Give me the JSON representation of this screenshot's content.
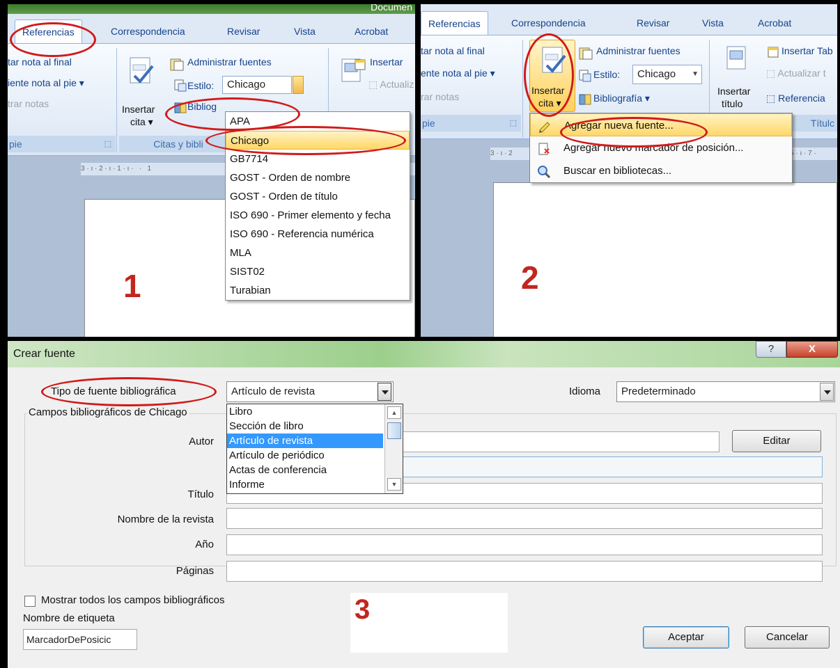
{
  "panel1": {
    "title_fragment": "Documen",
    "tabs": [
      "Referencias",
      "Correspondencia",
      "Revisar",
      "Vista",
      "Acrobat"
    ],
    "ribbon": {
      "footnote_cmds": [
        "tar nota al final",
        "iente nota al pie",
        "trar notas"
      ],
      "footnote_group": "pie",
      "insert_citation": [
        "Insertar",
        "cita"
      ],
      "manage_sources": "Administrar fuentes",
      "style_label": "Estilo:",
      "style_value": "Chicago",
      "bibliography_partial": "Bibliog",
      "citations_group": "Citas y bibli",
      "caption_partial": "Insertar",
      "update_partial": "Actualiz"
    },
    "ruler": "3 · ı · 2 · ı · 1 · ı ·   ·   1",
    "style_options": [
      "APA",
      "Chicago",
      "GB7714",
      "GOST - Orden de nombre",
      "GOST - Orden de título",
      "ISO 690 - Primer elemento y fecha",
      "ISO 690 - Referencia numérica",
      "MLA",
      "SIST02",
      "Turabian"
    ],
    "selected_style": "Chicago",
    "step": "1"
  },
  "panel2": {
    "tabs": [
      "Referencias",
      "Correspondencia",
      "Revisar",
      "Vista",
      "Acrobat"
    ],
    "ribbon": {
      "footnote_cmds": [
        "tar nota al final",
        "ente nota al pie",
        "rar notas"
      ],
      "footnote_group": "pie",
      "insert_citation": [
        "Insertar",
        "cita"
      ],
      "manage_sources": "Administrar fuentes",
      "style_label": "Estilo:",
      "style_value": "Chicago",
      "bibliography": "Bibliografía",
      "insert_caption": [
        "Insertar",
        "título"
      ],
      "insert_table_partial": "Insertar Tab",
      "update_partial": "Actualizar t",
      "cross_ref_partial": "Referencia",
      "caption_group_partial": "Títulc"
    },
    "ruler_left": "3 · ı · 2",
    "ruler_right": "5 · ı · 7 ·",
    "menu": [
      {
        "label": "Agregar nueva fuente...",
        "icon": "add-source-icon"
      },
      {
        "label": "Agregar nuevo marcador de posición...",
        "icon": "add-placeholder-icon"
      },
      {
        "label": "Buscar en bibliotecas...",
        "icon": "search-libraries-icon"
      }
    ],
    "step": "2"
  },
  "dialog": {
    "title": "Crear fuente",
    "help_button": "?",
    "close_button": "X",
    "source_type_label": "Tipo de fuente bibliográfica",
    "source_type_value": "Artículo de revista",
    "source_type_options": [
      "Libro",
      "Sección de libro",
      "Artículo de revista",
      "Artículo de periódico",
      "Actas de conferencia",
      "Informe"
    ],
    "language_label": "Idioma",
    "language_value": "Predeterminado",
    "fields_group_label": "Campos bibliográficos de Chicago",
    "fields": {
      "author_label": "Autor",
      "author_value": "",
      "title_label": "Título",
      "journal_label": "Nombre de la revista",
      "year_label": "Año",
      "pages_label": "Páginas"
    },
    "edit_button": "Editar",
    "show_all_label": "Mostrar todos los campos bibliográficos",
    "show_all_checked": false,
    "tag_name_label": "Nombre de etiqueta",
    "tag_name_value": "MarcadorDePosicic",
    "ok_button": "Aceptar",
    "cancel_button": "Cancelar",
    "step": "3"
  },
  "colors": {
    "annotation_red": "#d11a1a",
    "step_number": "#c2261e",
    "ribbon_text": "#15428b",
    "selection_blue": "#3399ff",
    "menu_highlight": "#ffd767"
  }
}
